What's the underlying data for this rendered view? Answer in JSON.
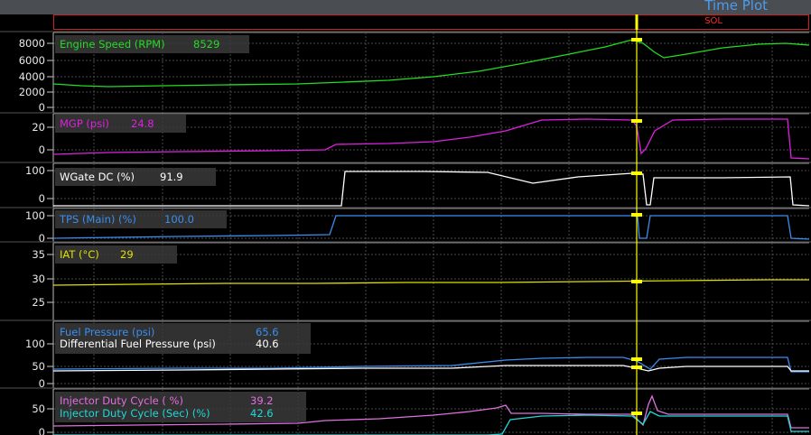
{
  "window": {
    "title": "Time Plot",
    "marker_label": "SOL"
  },
  "colors": {
    "background": "#000000",
    "grid": "#4a4a4a",
    "cursor": "#ffff00",
    "engine_speed": "#22dd22",
    "mgp": "#e020e0",
    "wgate": "#ffffff",
    "tps": "#3a8ef0",
    "iat": "#e0e000",
    "fuel_pressure": "#3a8ef0",
    "diff_fuel_pressure": "#ffffff",
    "inj_duty": "#e070e0",
    "inj_duty_sec": "#20d8d8"
  },
  "panels": [
    {
      "id": "rpm",
      "yticks": [
        "8000",
        "6000",
        "4000",
        "2000",
        "0"
      ],
      "series": [
        {
          "name": "Engine Speed (RPM)",
          "value": "8529",
          "color": "#22dd22"
        }
      ]
    },
    {
      "id": "mgp",
      "yticks": [
        "20",
        "0"
      ],
      "series": [
        {
          "name": "MGP (psi)",
          "value": "24.8",
          "color": "#e020e0"
        }
      ]
    },
    {
      "id": "wgate",
      "yticks": [
        "100",
        "0"
      ],
      "series": [
        {
          "name": "WGate DC (%)",
          "value": "91.9",
          "color": "#ffffff"
        }
      ]
    },
    {
      "id": "tps",
      "yticks": [
        "100",
        "0"
      ],
      "series": [
        {
          "name": "TPS (Main) (%)",
          "value": "100.0",
          "color": "#3a8ef0"
        }
      ]
    },
    {
      "id": "iat",
      "yticks": [
        "35",
        "30",
        "25"
      ],
      "series": [
        {
          "name": "IAT (°C)",
          "value": "29",
          "color": "#e0e000"
        }
      ]
    },
    {
      "id": "fuel",
      "yticks": [
        "100",
        "50",
        "0"
      ],
      "series": [
        {
          "name": "Fuel Pressure (psi)",
          "value": "65.6",
          "color": "#3a8ef0"
        },
        {
          "name": "Differential Fuel Pressure (psi)",
          "value": "40.6",
          "color": "#ffffff"
        }
      ]
    },
    {
      "id": "inj",
      "yticks": [
        "50",
        "0"
      ],
      "series": [
        {
          "name": "Injector Duty Cycle ( %)",
          "value": "39.2",
          "color": "#e070e0"
        },
        {
          "name": "Injector Duty Cycle (Sec) (%)",
          "value": "42.6",
          "color": "#20d8d8"
        }
      ]
    }
  ]
}
